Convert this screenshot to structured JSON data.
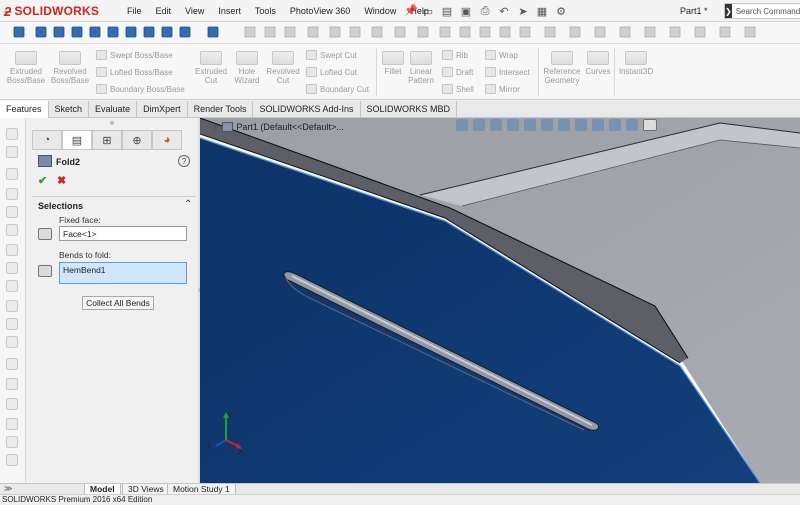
{
  "app": {
    "logo_text": "SOLIDWORKS",
    "document_name": "Part1 *",
    "search_placeholder": "Search Commands",
    "accent_color": "#d2231f"
  },
  "menu": [
    "File",
    "Edit",
    "View",
    "Insert",
    "Tools",
    "PhotoView 360",
    "Window",
    "Help"
  ],
  "quick_access_icons": [
    "new-icon",
    "open-icon",
    "save-icon",
    "print-icon",
    "undo-icon",
    "select-icon",
    "rebuild-icon",
    "options-icon"
  ],
  "command_manager": {
    "features": [
      {
        "label": "Extruded Boss/Base",
        "icon": "extruded-boss-icon"
      },
      {
        "label": "Revolved Boss/Base",
        "icon": "revolved-boss-icon"
      },
      {
        "label": "Swept Boss/Base",
        "icon": "swept-boss-icon"
      },
      {
        "label": "Lofted Boss/Base",
        "icon": "lofted-boss-icon"
      },
      {
        "label": "Boundary Boss/Base",
        "icon": "boundary-boss-icon"
      },
      {
        "label": "Extruded Cut",
        "icon": "extruded-cut-icon"
      },
      {
        "label": "Hole Wizard",
        "icon": "hole-wizard-icon"
      },
      {
        "label": "Revolved Cut",
        "icon": "revolved-cut-icon"
      },
      {
        "label": "Swept Cut",
        "icon": "swept-cut-icon"
      },
      {
        "label": "Lofted Cut",
        "icon": "lofted-cut-icon"
      },
      {
        "label": "Boundary Cut",
        "icon": "boundary-cut-icon"
      },
      {
        "label": "Fillet",
        "icon": "fillet-icon"
      },
      {
        "label": "Linear Pattern",
        "icon": "linear-pattern-icon"
      },
      {
        "label": "Rib",
        "icon": "rib-icon"
      },
      {
        "label": "Draft",
        "icon": "draft-icon"
      },
      {
        "label": "Shell",
        "icon": "shell-icon"
      },
      {
        "label": "Wrap",
        "icon": "wrap-icon"
      },
      {
        "label": "Intersect",
        "icon": "intersect-icon"
      },
      {
        "label": "Mirror",
        "icon": "mirror-icon"
      },
      {
        "label": "Reference Geometry",
        "icon": "reference-geometry-icon"
      },
      {
        "label": "Curves",
        "icon": "curves-icon"
      },
      {
        "label": "Instant3D",
        "icon": "instant3d-icon"
      }
    ],
    "tabs": [
      "Features",
      "Sketch",
      "Evaluate",
      "DimXpert",
      "Render Tools",
      "SOLIDWORKS Add-Ins",
      "SOLIDWORKS MBD"
    ],
    "active_tab": "Features"
  },
  "property_manager": {
    "feature_title": "Fold2",
    "help_glyph": "?",
    "ok_glyph": "✔",
    "cancel_glyph": "✖",
    "selections_title": "Selections",
    "fixed_face_label": "Fixed face:",
    "fixed_face_value": "Face<1>",
    "bends_to_fold_label": "Bends to fold:",
    "bends_to_fold_value": "HemBend1",
    "collect_button": "Collect All Bends"
  },
  "viewport": {
    "tree_label": "Part1  (Default<<Default>...",
    "model_blue": "#0f3a73",
    "model_grey": "#9a9ba3"
  },
  "bottom_tabs": [
    "Model",
    "3D Views",
    "Motion Study 1"
  ],
  "active_bottom_tab": "Model",
  "status_bar": "SOLIDWORKS Premium 2016 x64 Edition",
  "triad_axes": [
    "Z",
    "Y",
    "X"
  ]
}
